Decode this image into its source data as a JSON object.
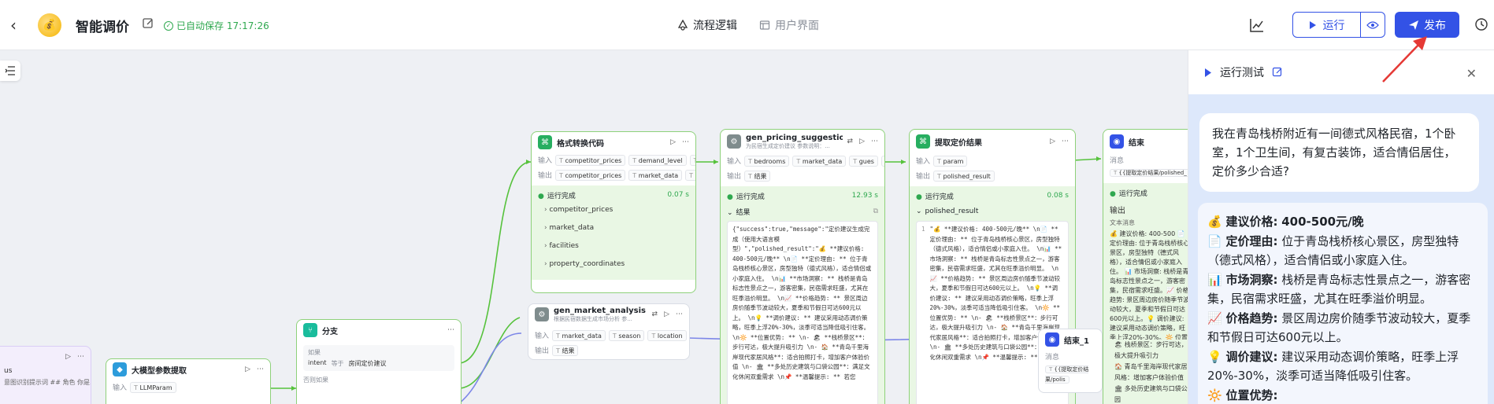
{
  "header": {
    "back_icon": "back-arrow-icon",
    "app_title": "智能调价",
    "autosave_text": "已自动保存 17:17:26",
    "tabs": [
      {
        "label": "流程逻辑",
        "active": true
      },
      {
        "label": "用户界面",
        "active": false
      }
    ],
    "run_label": "运行",
    "publish_label": "发布"
  },
  "nodes": {
    "format_code": {
      "title": "格式转换代码",
      "input_label": "输入",
      "output_label": "输出",
      "inputs": [
        "competitor_prices",
        "demand_level",
        "..."
      ],
      "outputs": [
        "competitor_prices",
        "market_data",
        "..."
      ],
      "status": "运行完成",
      "time": "0.07 s",
      "items": [
        "competitor_prices",
        "market_data",
        "facilities",
        "property_coordinates"
      ]
    },
    "pricing": {
      "title": "gen_pricing_suggestions",
      "subtitle": "为民宿生成定价建议 参数说明：...",
      "input_label": "输入",
      "output_label": "输出",
      "inputs": [
        "bedrooms",
        "market_data",
        "gues",
        "..."
      ],
      "outputs": [
        "结果"
      ],
      "status": "运行完成",
      "time": "12.93 s",
      "result_label": "结果",
      "code": "{\"success\":true,\"message\":\"定价建议生成完成（使用大语言模型）\",\"polished_result\":\"💰 **建议价格: 400-500元/晚** \\n📄 **定价理由: ** 位于青岛栈桥核心景区，房型独特（德式风格），适合情侣或小家庭入住。 \\n📊 **市场洞察: ** 栈桥是青岛标志性景点之一，游客密集，民宿需求旺盛，尤其在旺季溢价明显。 \\n📈 **价格趋势: ** 景区周边房价随季节波动较大，夏季和节假日可达600元以上。 \\n💡 **调价建议: ** 建议采用动态调价策略，旺季上浮20%-30%，淡季可适当降低吸引住客。 \\n🔆 **位置优势: ** \\n- 🏖 **栈桥景区**：步行可达，极大提升吸引力 \\n- 🏠 **青岛千里海岸现代家居风格**：适合拍照打卡，增加客户体验价值 \\n- 🏛 **多处历史建筑与口袋公园**：满足文化休闲双重需求 \\n📌 **温馨提示: ** 若您"
    },
    "extract": {
      "title": "提取定价结果",
      "input_label": "输入",
      "output_label": "输出",
      "inputs": [
        "param"
      ],
      "outputs": [
        "polished_result"
      ],
      "status": "运行完成",
      "time": "0.08 s",
      "result_label": "polished_result",
      "line_no": "1",
      "code": "\"💰 **建议价格: 400-500元/晚** \\n📄 **定价理由: ** 位于青岛栈桥核心景区，房型独特（德式风格），适合情侣或小家庭入住。 \\n📊 **市场洞察: ** 栈桥是青岛标志性景点之一，游客密集，民宿需求旺盛，尤其在旺季溢价明显。 \\n📈 **价格趋势: ** 景区周边房价随季节波动较大，夏季和节假日可达600元以上。 \\n💡 **调价建议: ** 建议采用动态调价策略，旺季上浮20%-30%，淡季可适当降低吸引住客。 \\n🔆 **位置优势: ** \\n- 🏖 **栈桥景区**：步行可达，极大提升吸引力 \\n- 🏠 **青岛千里海岸现代家居风格**：适合拍照打卡，增加客户体验价值 \\n- 🏛 **多处历史建筑与口袋公园**：满足文化休闲双重需求 \\n📌 **温馨提示: ** 若您"
    },
    "end": {
      "title": "结束",
      "message_label": "消息",
      "message_value": "{{提取定价结果/polished_",
      "status": "运行完成",
      "output_label": "输出",
      "text_label": "文本消息",
      "text": "💰 建议价格: 400-500 📄 定价理由: 位于青岛栈桥核心景区，房型独特（德式风格），适合情侣或小家庭入住。 📊 市场洞察: 栈桥是青岛标志性景点之一，游客密集，民宿需求旺盛。📈 价格趋势: 景区周边房价随季节波动较大，夏季和节假日可达600元以上。💡 调价建议: 建议采用动态调价策略，旺季上浮20%-30%。🔆 位置优势:",
      "bullets": [
        "🏖 栈桥景区：步行可达，极大提升吸引力",
        "🏠 青岛千里海岸现代家居风格：增加客户体验价值",
        "🏛 多处历史建筑与口袋公园"
      ]
    },
    "market": {
      "title": "gen_market_analysis",
      "subtitle": "根据民宿数据生成市场分析 参...",
      "input_label": "输入",
      "output_label": "输出",
      "inputs": [
        "market_data",
        "season",
        "location"
      ],
      "outputs": [
        "结果"
      ]
    },
    "end1": {
      "title": "结束_1",
      "message_label": "消息",
      "message_value": "{{提取定价结果/polis"
    },
    "branch": {
      "title": "分支",
      "if_label": "如果",
      "condition_var": "intent",
      "condition_op": "等于",
      "condition_value": "房间定价建议",
      "else_label": "否则如果"
    },
    "llm": {
      "title": "大模型参数提取",
      "input_label": "输入",
      "inputs": [
        "LLMParam"
      ]
    },
    "start": {
      "text": "us",
      "snippet": "意图识别提示词 ## 角色 你是..."
    }
  },
  "panel": {
    "title": "运行测试",
    "user_message": "我在青岛栈桥附近有一间德式风格民宿，1个卧室，1个卫生间，有复古装饰，适合情侣居住，定价多少合适?",
    "ai_lines": [
      {
        "emoji": "💰",
        "label": "建议价格:",
        "text": "400-500元/晚"
      },
      {
        "emoji": "📄",
        "label": "定价理由:",
        "text": "位于青岛栈桥核心景区，房型独特（德式风格），适合情侣或小家庭入住。"
      },
      {
        "emoji": "📊",
        "label": "市场洞察:",
        "text": "栈桥是青岛标志性景点之一，游客密集，民宿需求旺盛，尤其在旺季溢价明显。"
      },
      {
        "emoji": "📈",
        "label": "价格趋势:",
        "text": "景区周边房价随季节波动较大，夏季和节假日可达600元以上。"
      },
      {
        "emoji": "💡",
        "label": "调价建议:",
        "text": "建议采用动态调价策略，旺季上浮20%-30%，淡季可适当降低吸引住客。"
      },
      {
        "emoji": "🔆",
        "label": "位置优势:",
        "text": ""
      }
    ]
  },
  "colors": {
    "accent": "#3352e6",
    "success": "#2fa84f",
    "node_border": "#8ed17a",
    "annotation_arrow": "#e53935"
  }
}
